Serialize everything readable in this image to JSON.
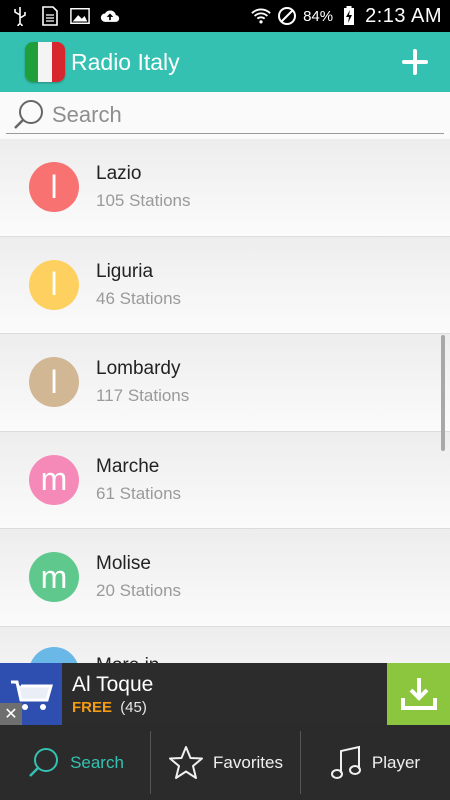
{
  "status_bar": {
    "battery_pct": "84%",
    "time": "2:13 AM"
  },
  "app_bar": {
    "title": "Radio Italy",
    "add_icon": "plus-icon"
  },
  "search": {
    "placeholder": "Search"
  },
  "regions": [
    {
      "initial": "l",
      "name": "Lazio",
      "stations": "105 Stations",
      "color": "#f87272"
    },
    {
      "initial": "l",
      "name": "Liguria",
      "stations": "46 Stations",
      "color": "#fed060"
    },
    {
      "initial": "l",
      "name": "Lombardy",
      "stations": "117 Stations",
      "color": "#d2b795"
    },
    {
      "initial": "m",
      "name": "Marche",
      "stations": "61 Stations",
      "color": "#f58ab8"
    },
    {
      "initial": "m",
      "name": "Molise",
      "stations": "20 Stations",
      "color": "#5fc88c"
    },
    {
      "initial": "",
      "name": "More in",
      "stations": "",
      "color": "#6ab8e8"
    }
  ],
  "ad": {
    "name": "Al Toque",
    "free_label": "FREE",
    "count": "(45)",
    "close": "✕"
  },
  "bottom_nav": {
    "search_label": "Search",
    "favorites_label": "Favorites",
    "player_label": "Player"
  },
  "colors": {
    "accent": "#35c1b1",
    "ad_download": "#8cc63f"
  }
}
